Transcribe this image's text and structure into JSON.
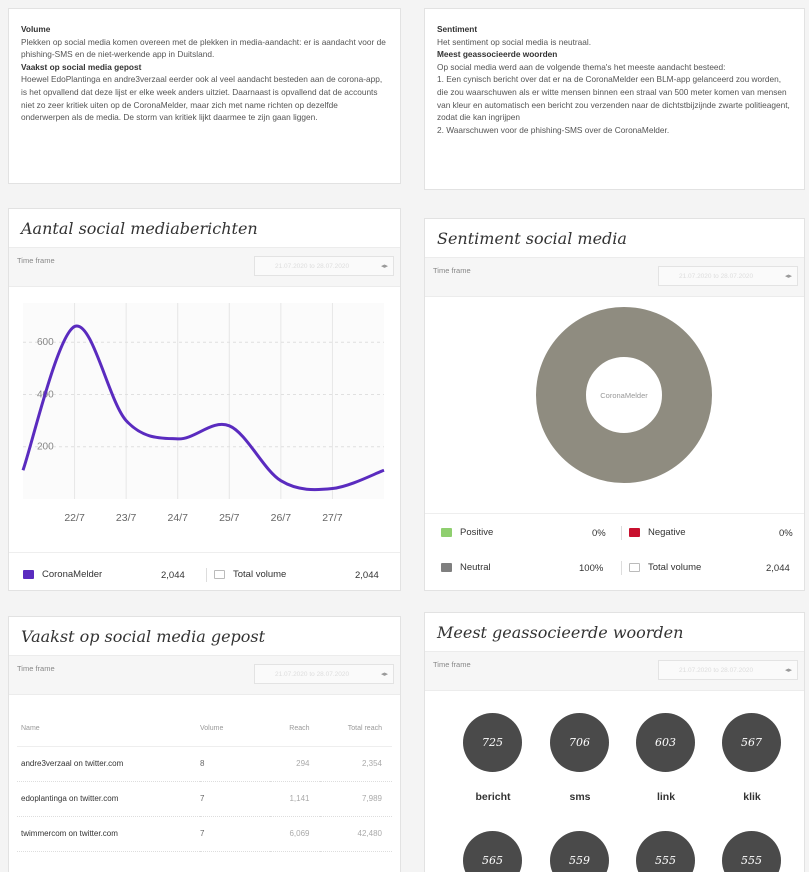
{
  "volume_card": {
    "volume_heading": "Volume",
    "volume_text": "Plekken op social media komen overeen met de plekken in media-aandacht: er is aandacht voor de phishing-SMS en de niet-werkende app in Duitsland.",
    "posted_heading": "Vaakst op social media gepost",
    "posted_text": "Hoewel EdoPlantinga en andre3verzaal eerder ook al veel aandacht besteden aan de corona-app, is het opvallend dat deze lijst er elke week anders uitziet. Daarnaast is opvallend dat de accounts niet zo zeer kritiek uiten op de CoronaMelder, maar zich met name richten op dezelfde onderwerpen als de media. De storm van kritiek lijkt daarmee te zijn gaan liggen."
  },
  "sentiment_card": {
    "sentiment_heading": "Sentiment",
    "sentiment_text": "Het sentiment op social media is neutraal.",
    "words_heading": "Meest geassocieerde woorden",
    "words_intro": "Op social media werd aan de volgende thema's het meeste aandacht besteed:",
    "item1": "1. Een cynisch bericht over dat er na de CoronaMelder een BLM-app gelanceerd zou worden, die zou waarschuwen als er witte mensen binnen een straal van 500 meter komen van mensen van kleur en automatisch een bericht zou verzenden naar de dichtstbijzijnde zwarte politieagent, zodat die kan ingrijpen",
    "item2": "2. Waarschuwen voor de phishing-SMS over de CoronaMelder."
  },
  "time_frame_label": "Time frame",
  "time_frame_value": "21.07.2020 to 28.07.2020",
  "messages_panel": {
    "title": "Aantal social mediaberichten",
    "legend_series": "CoronaMelder",
    "series_total": "2,044",
    "legend_total": "Total volume",
    "total_value": "2,044"
  },
  "sentiment_panel": {
    "title": "Sentiment social media",
    "donut_label": "CoronaMelder",
    "positive_label": "Positive",
    "positive_value": "0%",
    "negative_label": "Negative",
    "negative_value": "0%",
    "neutral_label": "Neutral",
    "neutral_value": "100%",
    "total_label": "Total volume",
    "total_value": "2,044"
  },
  "posted_panel": {
    "title": "Vaakst op social media gepost",
    "columns": [
      "Name",
      "Volume",
      "Reach",
      "Total reach"
    ],
    "rows": [
      {
        "name": "andre3verzaal on twitter.com",
        "volume": "8",
        "reach": "294",
        "total": "2,354"
      },
      {
        "name": "edoplantinga on twitter.com",
        "volume": "7",
        "reach": "1,141",
        "total": "7,989"
      },
      {
        "name": "twimmercom on twitter.com",
        "volume": "7",
        "reach": "6,069",
        "total": "42,480"
      }
    ]
  },
  "words_panel": {
    "title": "Meest geassocieerde woorden",
    "words": [
      {
        "count": "725",
        "word": "bericht"
      },
      {
        "count": "706",
        "word": "sms"
      },
      {
        "count": "603",
        "word": "link"
      },
      {
        "count": "567",
        "word": "klik"
      },
      {
        "count": "565",
        "word": ""
      },
      {
        "count": "559",
        "word": ""
      },
      {
        "count": "555",
        "word": ""
      },
      {
        "count": "555",
        "word": ""
      }
    ]
  },
  "colors": {
    "series_line": "#5a2bbf",
    "donut_neutral": "#8f8c80",
    "positive": "#8fcf6f",
    "negative": "#c8102e",
    "neutral": "#7f7f7f",
    "word_bubble": "#4a4a4a"
  },
  "chart_data": [
    {
      "type": "line",
      "x": [
        "21/7",
        "22/7",
        "23/7",
        "24/7",
        "25/7",
        "26/7",
        "27/7",
        "28/7"
      ],
      "xticks": [
        "22/7",
        "23/7",
        "24/7",
        "25/7",
        "26/7",
        "27/7"
      ],
      "yticks": [
        "200",
        "400",
        "600"
      ],
      "series": [
        {
          "name": "CoronaMelder",
          "values": [
            110,
            660,
            300,
            230,
            280,
            70,
            40,
            110
          ]
        }
      ],
      "ylim": [
        0,
        750
      ],
      "grid": true
    },
    {
      "type": "pie",
      "categories": [
        "Neutral",
        "Positive",
        "Negative"
      ],
      "values": [
        100,
        0,
        0
      ],
      "center_label": "CoronaMelder"
    }
  ]
}
